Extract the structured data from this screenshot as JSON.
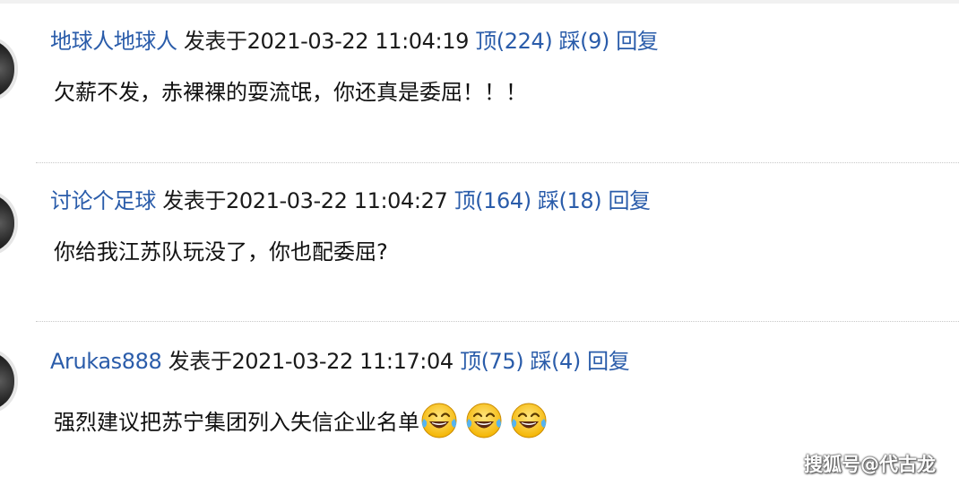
{
  "comments": [
    {
      "author": "地球人地球人",
      "posted_label": "发表于2021-03-22 11:04:19",
      "up_label": "顶(224)",
      "down_label": "踩(9)",
      "reply_label": "回复",
      "text": "欠薪不发，赤裸裸的耍流氓，你还真是委屈！！！"
    },
    {
      "author": "讨论个足球",
      "posted_label": "发表于2021-03-22 11:04:27",
      "up_label": "顶(164)",
      "down_label": "踩(18)",
      "reply_label": "回复",
      "text": "你给我江苏队玩没了，你也配委屈?"
    },
    {
      "author": "Arukas888",
      "posted_label": "发表于2021-03-22 11:17:04",
      "up_label": "顶(75)",
      "down_label": "踩(4)",
      "reply_label": "回复",
      "text": "强烈建议把苏宁集团列入失信企业名单",
      "emojis": [
        "laughing-tears-icon",
        "laughing-tears-icon",
        "laughing-tears-icon"
      ]
    }
  ],
  "watermark": "搜狐号@代古龙",
  "colors": {
    "link": "#2a5caa",
    "text": "#111111",
    "divider": "#c8c8c8"
  }
}
